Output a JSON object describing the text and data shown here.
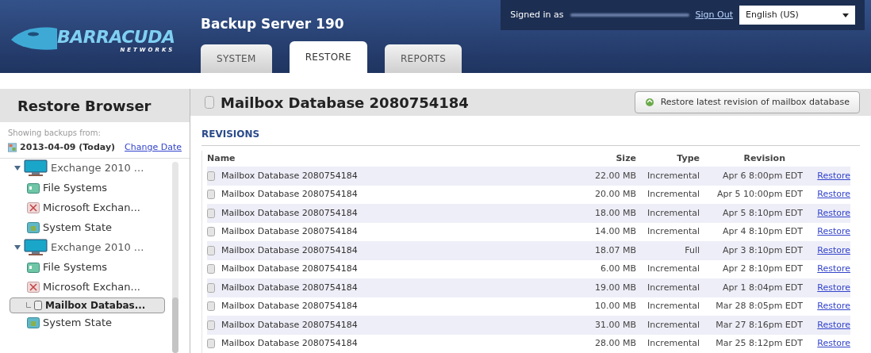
{
  "logo": {
    "name": "BARRACUDA",
    "tagline": "NETWORKS"
  },
  "header": {
    "title": "Backup Server 190",
    "signed_in_label": "Signed in as",
    "sign_out": "Sign Out",
    "language": "English (US)"
  },
  "tabs": [
    {
      "label": "SYSTEM",
      "selected": false
    },
    {
      "label": "RESTORE",
      "selected": true
    },
    {
      "label": "REPORTS",
      "selected": false
    }
  ],
  "sidebar": {
    "title": "Restore Browser",
    "showing_label": "Showing backups from:",
    "date": "2013-04-09 (Today)",
    "change_date": "Change Date",
    "tree": [
      {
        "label": "Exchange 2010 ...",
        "kind": "computer",
        "expanded": true,
        "selected": false,
        "children": [
          {
            "label": "File Systems",
            "kind": "files",
            "selected": false
          },
          {
            "label": "Microsoft Exchan...",
            "kind": "exchange",
            "selected": false
          },
          {
            "label": "System State",
            "kind": "state",
            "selected": false
          }
        ]
      },
      {
        "label": "Exchange 2010 ...",
        "kind": "computer",
        "expanded": true,
        "selected": false,
        "children": [
          {
            "label": "File Systems",
            "kind": "files",
            "selected": false
          },
          {
            "label": "Microsoft Exchan...",
            "kind": "exchange",
            "selected": false,
            "children": [
              {
                "label": "Mailbox Databas...",
                "kind": "database",
                "selected": true
              }
            ]
          },
          {
            "label": "System State",
            "kind": "state",
            "selected": false
          }
        ]
      }
    ]
  },
  "main": {
    "title": "Mailbox Database 2080754184",
    "restore_button": "Restore latest revision of mailbox database",
    "section": "REVISIONS",
    "table": {
      "columns": [
        "Name",
        "Size",
        "Type",
        "Revision"
      ],
      "rows": [
        {
          "name": "Mailbox Database 2080754184",
          "size": "22.00 MB",
          "type": "Incremental",
          "revision": "Apr 6 8:00pm EDT",
          "action": "Restore"
        },
        {
          "name": "Mailbox Database 2080754184",
          "size": "20.00 MB",
          "type": "Incremental",
          "revision": "Apr 5 10:00pm EDT",
          "action": "Restore"
        },
        {
          "name": "Mailbox Database 2080754184",
          "size": "18.00 MB",
          "type": "Incremental",
          "revision": "Apr 5 8:10pm EDT",
          "action": "Restore"
        },
        {
          "name": "Mailbox Database 2080754184",
          "size": "14.00 MB",
          "type": "Incremental",
          "revision": "Apr 4 8:10pm EDT",
          "action": "Restore"
        },
        {
          "name": "Mailbox Database 2080754184",
          "size": "18.07 MB",
          "type": "Full",
          "revision": "Apr 3 8:10pm EDT",
          "action": "Restore"
        },
        {
          "name": "Mailbox Database 2080754184",
          "size": "6.00 MB",
          "type": "Incremental",
          "revision": "Apr 2 8:10pm EDT",
          "action": "Restore"
        },
        {
          "name": "Mailbox Database 2080754184",
          "size": "19.00 MB",
          "type": "Incremental",
          "revision": "Apr 1 8:04pm EDT",
          "action": "Restore"
        },
        {
          "name": "Mailbox Database 2080754184",
          "size": "10.00 MB",
          "type": "Incremental",
          "revision": "Mar 28 8:05pm EDT",
          "action": "Restore"
        },
        {
          "name": "Mailbox Database 2080754184",
          "size": "31.00 MB",
          "type": "Incremental",
          "revision": "Mar 27 8:16pm EDT",
          "action": "Restore"
        },
        {
          "name": "Mailbox Database 2080754184",
          "size": "28.00 MB",
          "type": "Incremental",
          "revision": "Mar 25 8:12pm EDT",
          "action": "Restore"
        }
      ]
    }
  }
}
